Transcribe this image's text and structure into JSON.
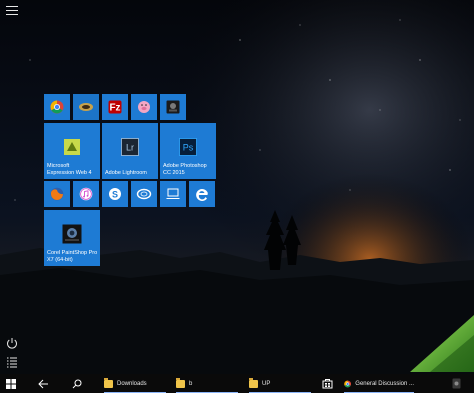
{
  "desktop": {
    "sky_top": "#04060b",
    "glow": "#b8621e",
    "accent": "#1e7bd4"
  },
  "tiles": {
    "expression_label": "Microsoft Expression Web 4",
    "lightroom_label": "Adobe Lightroom",
    "lightroom_glyph": "Lr",
    "photoshop_label": "Adobe Photoshop CC 2015",
    "photoshop_glyph": "Ps",
    "paintshop_label": "Corel PaintShop Pro X7 (64-bit)"
  },
  "taskbar": {
    "downloads_label": "Downloads",
    "b_label": "b",
    "up_label": "UP",
    "chrome_label": "General Discussion ..."
  },
  "icons": [
    "hamburger-icon",
    "power-icon",
    "all-apps-icon",
    "windows-icon",
    "back-icon",
    "search-icon",
    "folder-icon",
    "store-icon",
    "chrome-icon",
    "filezilla-icon",
    "firefox-icon",
    "itunes-icon",
    "skype-icon",
    "edge-icon"
  ]
}
